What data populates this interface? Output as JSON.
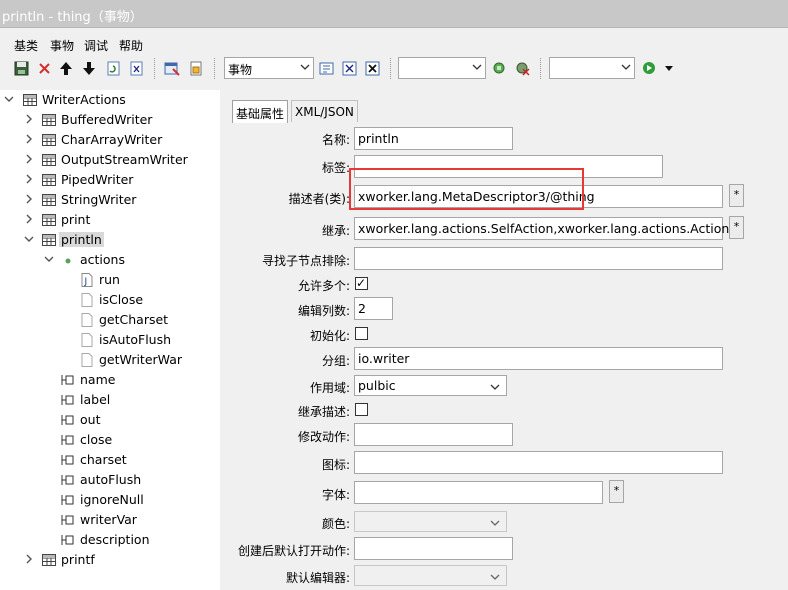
{
  "window": {
    "title": "println - thing（事物）"
  },
  "menu": {
    "items": [
      "基类",
      "事物",
      "调试",
      "帮助"
    ]
  },
  "toolbar": {
    "icons": [
      "save-icon",
      "delete-icon",
      "arrow-up-icon",
      "arrow-down-icon",
      "refresh-icon",
      "xml-icon",
      "edit-icon",
      "package-icon",
      "thing-icon",
      "close-x-icon",
      "close-xx-icon",
      "plugin-green-icon",
      "plugin-x-icon",
      "run-icon",
      "dropdown-icon"
    ],
    "combo1": "事物",
    "combo2": "",
    "combo3": ""
  },
  "tree": {
    "root": "WriterActions",
    "items": [
      {
        "label": "BufferedWriter"
      },
      {
        "label": "CharArrayWriter"
      },
      {
        "label": "OutputStreamWriter"
      },
      {
        "label": "PipedWriter"
      },
      {
        "label": "StringWriter"
      },
      {
        "label": "print"
      },
      {
        "label": "println"
      },
      {
        "label": "actions"
      },
      {
        "label": "run"
      },
      {
        "label": "isClose"
      },
      {
        "label": "getCharset"
      },
      {
        "label": "isAutoFlush"
      },
      {
        "label": "getWriterWar"
      },
      {
        "label": "name"
      },
      {
        "label": "label"
      },
      {
        "label": "out"
      },
      {
        "label": "close"
      },
      {
        "label": "charset"
      },
      {
        "label": "autoFlush"
      },
      {
        "label": "ignoreNull"
      },
      {
        "label": "writerVar"
      },
      {
        "label": "description"
      },
      {
        "label": "printf"
      }
    ]
  },
  "tabs": [
    "基础属性",
    "XML/JSON"
  ],
  "form": {
    "name_label": "名称:",
    "name_value": "println",
    "label_label": "标签:",
    "label_value": "",
    "descriptor_label": "描述者(类):",
    "descriptor_value": "xworker.lang.MetaDescriptor3/@thing",
    "descriptor_btn": "*",
    "extends_label": "继承:",
    "extends_value": "xworker.lang.actions.SelfAction,xworker.lang.actions.Actions",
    "extends_btn": "*",
    "excludes_label": "寻找子节点排除:",
    "excludes_value": "",
    "many_label": "允许多个:",
    "many_checked": true,
    "many_mark": "✓",
    "editcols_label": "编辑列数:",
    "editcols_value": "2",
    "init_label": "初始化:",
    "init_checked": false,
    "group_label": "分组:",
    "group_value": "io.writer",
    "scope_label": "作用域:",
    "scope_value": "pulbic",
    "inherit_label": "继承描述:",
    "inherit_checked": false,
    "modify_label": "修改动作:",
    "modify_value": "",
    "icon_label": "图标:",
    "icon_value": "",
    "font_label": "字体:",
    "font_value": "",
    "font_btn": "*",
    "color_label": "颜色:",
    "color_value": "",
    "openaction_label": "创建后默认打开动作:",
    "openaction_value": "",
    "editor_label": "默认编辑器:",
    "editor_value": ""
  },
  "colors": {
    "highlight": "#e53935",
    "titlebar": "#c8c8c8"
  }
}
